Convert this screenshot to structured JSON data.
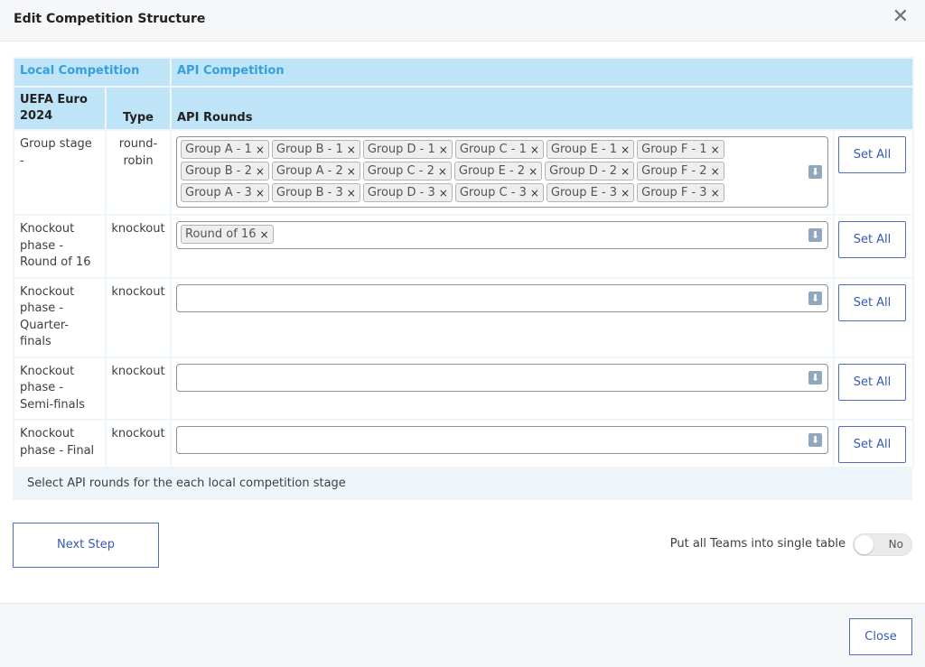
{
  "modal": {
    "title": "Edit Competition Structure",
    "close_icon": "close-icon"
  },
  "table": {
    "local_header": "Local Competition",
    "api_header": "API Competition",
    "competition_name": "UEFA Euro 2024",
    "type_header": "Type",
    "rounds_header": "API Rounds",
    "rows": [
      {
        "stage": "Group stage -",
        "type": "round-robin",
        "tags": [
          "Group A - 1",
          "Group B - 1",
          "Group D - 1",
          "Group C - 1",
          "Group E - 1",
          "Group F - 1",
          "Group B - 2",
          "Group A - 2",
          "Group C - 2",
          "Group E - 2",
          "Group D - 2",
          "Group F - 2",
          "Group A - 3",
          "Group B - 3",
          "Group D - 3",
          "Group C - 3",
          "Group E - 3",
          "Group F - 3"
        ],
        "button": "Set All"
      },
      {
        "stage": "Knockout phase - Round of 16",
        "type": "knockout",
        "tags": [
          "Round of 16"
        ],
        "button": "Set All"
      },
      {
        "stage": "Knockout phase - Quarter-finals",
        "type": "knockout",
        "tags": [],
        "button": "Set All"
      },
      {
        "stage": "Knockout phase - Semi-finals",
        "type": "knockout",
        "tags": [],
        "button": "Set All"
      },
      {
        "stage": "Knockout phase - Final",
        "type": "knockout",
        "tags": [],
        "button": "Set All"
      }
    ],
    "tag_remove_glyph": "×",
    "dropdown_icon": "dropdown-arrow-icon"
  },
  "notice": "Select API rounds for the each local competition stage",
  "next_button": "Next Step",
  "toggle": {
    "label": "Put all Teams into single table",
    "value": "No"
  },
  "footer": {
    "close_button": "Close"
  },
  "colors": {
    "header_bg": "#bfe3f7",
    "accent": "#35a0dc",
    "button": "#3a59b3"
  }
}
